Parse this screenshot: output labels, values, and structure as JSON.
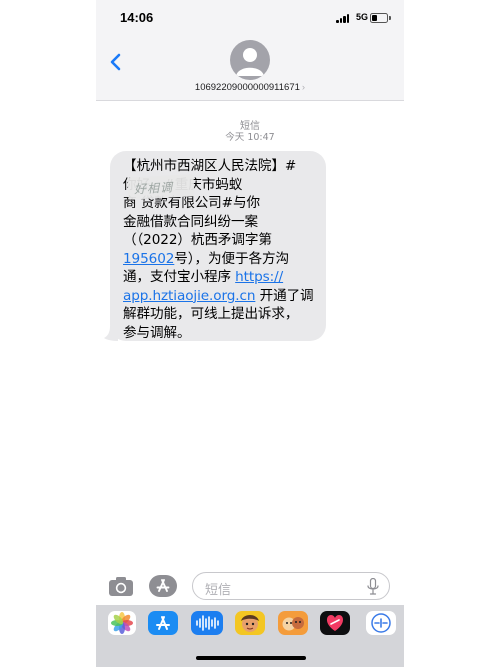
{
  "status_bar": {
    "time": "14:06",
    "network": "5G",
    "signal_icon": "cellular-signal-icon",
    "battery_icon": "battery-icon",
    "battery_level": 0.3
  },
  "header": {
    "back_icon": "chevron-left-icon",
    "avatar_icon": "person-icon",
    "contact_number": "10692209000000911671",
    "contact_chevron": "›"
  },
  "conversation": {
    "label": "短信",
    "timestamp": "今天 10:47",
    "message": {
      "lines": [
        "【杭州市西湖区人民法院】#",
        "               你好，#重庆市蚂蚁",
        "商       贷款有限公司#与你",
        "金融借款合同纠纷一案",
        "（（2022）杭西矛调字第"
      ],
      "line6": {
        "number": "195602",
        "rest": "号），为便于各方沟"
      },
      "line7": {
        "text": "通，支付宝小程序 ",
        "link": "https://"
      },
      "line8": {
        "link": "app.hztiaojie.org.cn",
        "rest": " 开通了调"
      },
      "lines_end": [
        "解群功能，可线上提出诉求，",
        "参与调解。"
      ],
      "redaction_text": "好相调"
    },
    "link_color": "#1a73e8",
    "bubble_color": "#e9e9eb"
  },
  "input_bar": {
    "camera_icon": "camera-icon",
    "apps_icon": "app-store-icon",
    "placeholder": "短信",
    "mic_icon": "microphone-icon"
  },
  "app_drawer": {
    "apps": [
      {
        "name": "photos-app-icon"
      },
      {
        "name": "app-store-icon"
      },
      {
        "name": "audio-message-app-icon"
      },
      {
        "name": "memoji-app-icon"
      },
      {
        "name": "memoji-stickers-app-icon"
      },
      {
        "name": "digital-touch-app-icon"
      },
      {
        "name": "ifly-app-icon"
      }
    ]
  }
}
